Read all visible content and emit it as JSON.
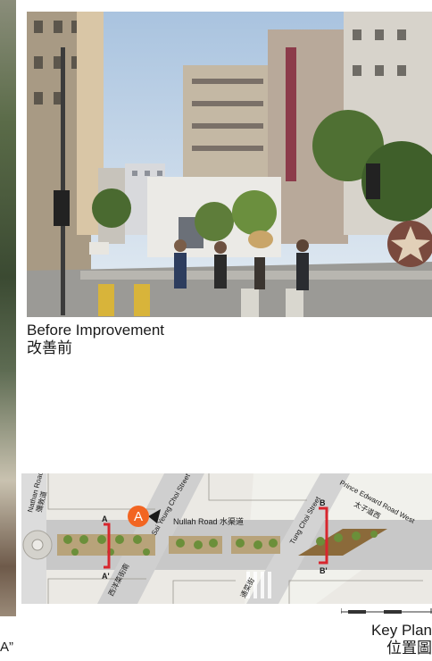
{
  "left_fragment": {
    "text": "A”"
  },
  "before_caption": {
    "en": "Before Improvement",
    "zh": "改善前"
  },
  "key_plan": {
    "en": "Key Plan",
    "zh": "位置圖"
  },
  "map": {
    "marker": "A",
    "nullah_road": "Nullah Road 水渠道",
    "sai_yeung_choi": "Sai Yeung Choi Street",
    "tung_choi": "Tung Choi Street",
    "prince_edward_en": "Prince Edward Road West",
    "prince_edward_zh": "太子道西",
    "nathan_en": "Nathan Road",
    "nathan_zh": "彌敦道",
    "sai_yeung_choi_zh": "西洋菜街南",
    "tung_choi_zh": "通菜街",
    "section_a_top": "A",
    "section_a_bottom": "A'",
    "section_b_top": "B",
    "section_b_bottom": "B'"
  },
  "colors": {
    "marker": "#f26522",
    "section_line": "#d7262e",
    "planting": "#6b8f3a"
  }
}
